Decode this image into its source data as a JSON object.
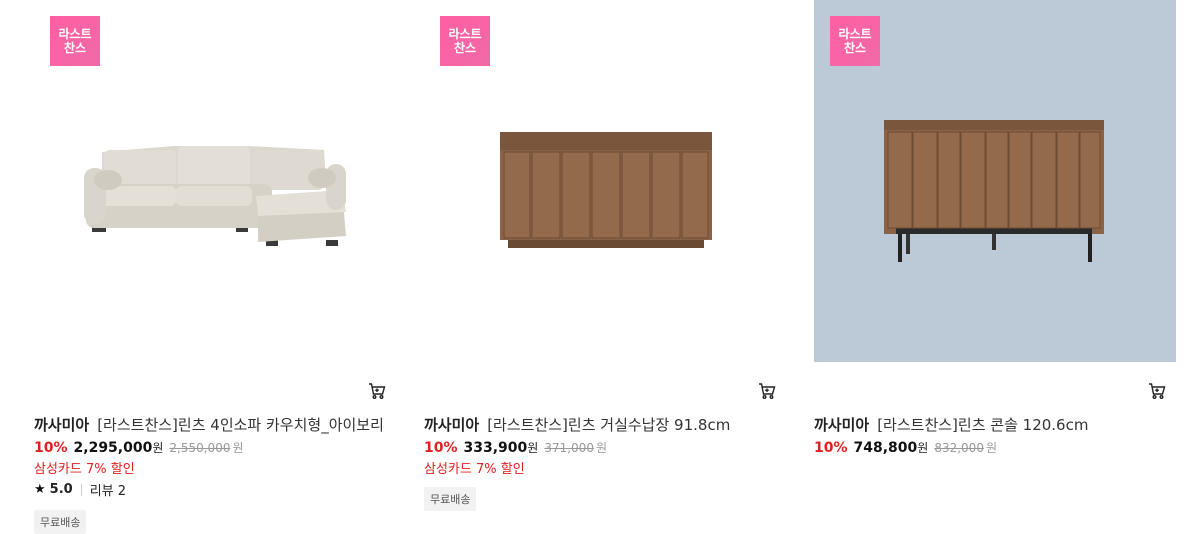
{
  "products": [
    {
      "badge": "라스트 찬스",
      "brand": "까사미아",
      "name": "[라스트찬스]린츠 4인소파 카우치형_아이보리",
      "discount": "10%",
      "price": "2,295,000",
      "currency": "원",
      "original_price": "2,550,000",
      "promo": "삼성카드 7% 할인",
      "rating": "5.0",
      "review_label": "리뷰 2",
      "tag": "무료배송"
    },
    {
      "badge": "라스트 찬스",
      "brand": "까사미아",
      "name": "[라스트찬스]린츠 거실수납장 91.8cm",
      "discount": "10%",
      "price": "333,900",
      "currency": "원",
      "original_price": "371,000",
      "promo": "삼성카드 7% 할인",
      "tag": "무료배송"
    },
    {
      "badge": "라스트 찬스",
      "brand": "까사미아",
      "name": "[라스트찬스]린츠 콘솔 120.6cm",
      "discount": "10%",
      "price": "748,800",
      "currency": "원",
      "original_price": "832,000"
    }
  ],
  "icons": {
    "cart": "cart-icon",
    "star": "star-icon"
  },
  "colors": {
    "badge": "#ff5fa2",
    "discount": "#e02020",
    "thumb_bg_3": "#bccad8"
  }
}
